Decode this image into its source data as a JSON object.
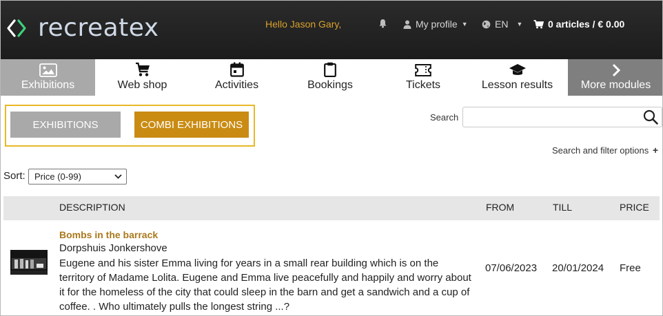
{
  "header": {
    "logo_text": "recreatex",
    "greeting": "Hello Jason Gary,",
    "profile_label": "My profile",
    "language": "EN",
    "cart_label": "0 articles / € 0.00"
  },
  "nav": {
    "items": [
      {
        "label": "Exhibitions",
        "icon": "image-icon"
      },
      {
        "label": "Web shop",
        "icon": "cart-icon"
      },
      {
        "label": "Activities",
        "icon": "calendar-icon"
      },
      {
        "label": "Bookings",
        "icon": "clipboard-icon"
      },
      {
        "label": "Tickets",
        "icon": "ticket-icon"
      },
      {
        "label": "Lesson results",
        "icon": "graduation-cap-icon"
      },
      {
        "label": "More modules",
        "icon": "chevron-right-icon"
      }
    ]
  },
  "tabs": {
    "exhibitions": "EXHIBITIONS",
    "combi": "COMBI EXHIBITIONS"
  },
  "search": {
    "label": "Search",
    "value": "",
    "filter_label": "Search and filter options"
  },
  "sort": {
    "label": "Sort:",
    "selected": "Price (0-99)"
  },
  "table": {
    "headers": {
      "description": "DESCRIPTION",
      "from": "FROM",
      "till": "TILL",
      "price": "PRICE"
    },
    "rows": [
      {
        "title": "Bombs in the barrack",
        "venue": "Dorpshuis Jonkershove",
        "description": "Eugene and his sister Emma living for years in a small rear building which is on the territory of Madame Lolita. Eugene and Emma live peacefully and happily and worry about it for the homeless of the city that could sleep in the barn and get a sandwich and a cup of coffee. . Who ultimately pulls the longest string ...?",
        "from": "07/06/2023",
        "till": "20/01/2024",
        "price": "Free"
      }
    ]
  },
  "colors": {
    "accent_gold": "#c98b12",
    "link_brown": "#a9781a",
    "greeting_orange": "#d9a12b",
    "header_bg": "#222222",
    "tab_border": "#e8b826",
    "active_nav": "#a9a9a9",
    "more_nav": "#7f7f7f"
  }
}
